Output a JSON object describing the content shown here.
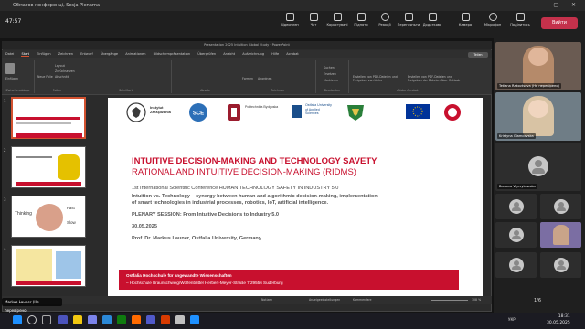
{
  "window": {
    "title": "Обмагов конференці, Sesja Plenarna"
  },
  "meeting": {
    "timer": "47:57",
    "toolbar": [
      {
        "label": "Відеоплен",
        "icon": "video-icon"
      },
      {
        "label": "Чат",
        "icon": "chat-icon"
      },
      {
        "label": "Користувачі",
        "icon": "people-icon",
        "count": "30"
      },
      {
        "label": "Підняти",
        "icon": "hand-icon"
      },
      {
        "label": "Реакції",
        "icon": "reaction-icon"
      },
      {
        "label": "Перегляньти",
        "icon": "view-icon"
      },
      {
        "label": "Додатково",
        "icon": "more-icon"
      }
    ],
    "media": [
      {
        "label": "Камера",
        "icon": "camera-icon"
      },
      {
        "label": "Мікрофон",
        "icon": "mic-icon"
      },
      {
        "label": "Поділитись",
        "icon": "share-icon"
      }
    ],
    "leave_label": "Вийти",
    "presenter": "Markus Launer (Не перевірено)",
    "page_counter": "1/6"
  },
  "powerpoint": {
    "title": "Presentation 2025 Intuition Global Study  ·  PowerPoint",
    "tabs": [
      "Datei",
      "Start",
      "Einfügen",
      "Zeichnen",
      "Entwurf",
      "Übergänge",
      "Animationen",
      "Bildschirmpräsentation",
      "Überprüfen",
      "Ansicht",
      "Aufzeichnung",
      "Hilfe",
      "Acrobat"
    ],
    "active_tab": "Start",
    "share_label": "Teilen",
    "ribbon_groups": [
      "Zwischenablage",
      "Folien",
      "Schriftart",
      "Absatz",
      "Zeichnen",
      "Bearbeiten",
      "Adobe Acrobat"
    ],
    "ribbon_buttons": {
      "paste": "Einfügen",
      "new_slide": "Neue Folie",
      "layout": "Layout",
      "reset": "Zurücksetzen",
      "section": "Abschnitt",
      "find": "Suchen",
      "replace": "Ersetzen",
      "select": "Markieren",
      "shapes": "Formen",
      "arrange": "Anordnen",
      "pdf_share": "Erstellen von PDF-Dateien und Freigeben von Links",
      "pdf_outlook": "Erstellen von PDF-Dateien und Freigeben der Dateien über Outlook"
    },
    "status": {
      "notes": "Notizen",
      "comments": "Anzeigeeinstellungen",
      "comment2": "Kommentare",
      "zoom": "108 %"
    },
    "thumb_numbers": [
      "1",
      "2",
      "3",
      "4"
    ],
    "thumb3_words": [
      "Thinking",
      "Fast",
      "Slow"
    ]
  },
  "slide": {
    "logos": [
      "Instytut Zarządzania",
      "SCE",
      "Politechnika Bydgoska",
      "Ostfalia University of Applied Sciences",
      "",
      "",
      ""
    ],
    "title_line1": "INTUITIVE DECISION-MAKING AND TECHNOLOGY SAVETY",
    "title_line2": "RATIONAL AND INTUITIVE DECISION-MAKING (RIDMS)",
    "line_conference": "1st International Scientific Conference HUMAN TECHNOLOGY SAFETY IN INDUSTRY 5.0",
    "line_topic1": "Intuition vs. Technology – synergy between human and algorithmic decision-making, implementation",
    "line_topic2": "of smart technologies in industrial processes, robotics, IoT, artificial intelligence.",
    "line_session": "PLENARY SESSION: From Intuitive Decisions to Industry 5.0",
    "line_date": "30.05.2025",
    "line_author": "Prof. Dr. Markus Launer, Ostfalia University, Germany",
    "footer1": "Ostfalia Hochschule für angewandte Wissenschaften",
    "footer2": "– Hochschule Braunschweig/Wolfenbüttel   Herbert-Meyer-Straße 7   29556 Suderburg"
  },
  "participants": [
    {
      "name": "Tetiana Rakovtsova (Не перевірено)"
    },
    {
      "name": "Kristyna Glamcevska"
    },
    {
      "name": "Barbara Wyrzykowska"
    },
    {
      "name": ""
    },
    {
      "name": ""
    }
  ],
  "taskbar": {
    "lang": "УКР",
    "time": "18:31",
    "date": "30.05.2025",
    "colors": [
      "#1e90ff",
      "#4b53bc",
      "#f2c811",
      "#7b83eb",
      "#2b88d8",
      "#0f7b0f",
      "#ff6a00",
      "#5059c9",
      "#d83b01",
      "#c0c0c0"
    ]
  }
}
